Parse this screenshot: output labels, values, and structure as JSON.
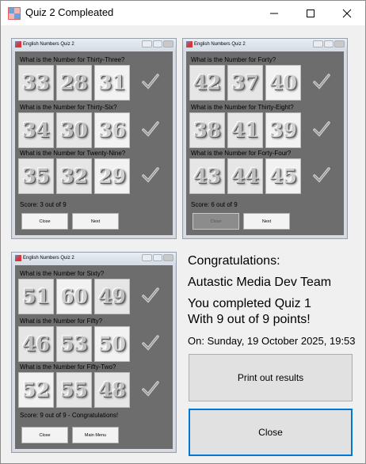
{
  "window": {
    "title": "Quiz 2 Compleated",
    "controls": [
      "minimize",
      "maximize",
      "close"
    ]
  },
  "screenshots": [
    {
      "title": "English Numbers Quiz 2",
      "questions": [
        {
          "text": "What is the Number for Thirty-Three?",
          "options": [
            "33",
            "28",
            "31"
          ]
        },
        {
          "text": "What is the Number for Thirty-Six?",
          "options": [
            "34",
            "30",
            "36"
          ]
        },
        {
          "text": "What is the Number for Twenty-Nine?",
          "options": [
            "35",
            "32",
            "29"
          ]
        }
      ],
      "score": "Score: 3 out of 9",
      "buttons": [
        "Close",
        "Next"
      ]
    },
    {
      "title": "English Numbers Quiz 2",
      "questions": [
        {
          "text": "What is the Number for Forty?",
          "options": [
            "42",
            "37",
            "40"
          ]
        },
        {
          "text": "What is the Number for Thirty-Eight?",
          "options": [
            "38",
            "41",
            "39"
          ]
        },
        {
          "text": "What is the Number for Forty-Four?",
          "options": [
            "43",
            "44",
            "45"
          ]
        }
      ],
      "score": "Score: 6 out of 9",
      "buttons": [
        "Close",
        "Next"
      ]
    },
    {
      "title": "English Numbers Quiz 2",
      "questions": [
        {
          "text": "What is the Number for Sixty?",
          "options": [
            "51",
            "60",
            "49"
          ]
        },
        {
          "text": "What is the Number for Fifty?",
          "options": [
            "46",
            "53",
            "50"
          ]
        },
        {
          "text": "What is the Number for Fifty-Two?",
          "options": [
            "52",
            "55",
            "48"
          ]
        }
      ],
      "score": "Score: 9 out of 9 - Congratulations!",
      "buttons": [
        "Close",
        "Main Menu"
      ]
    }
  ],
  "results": {
    "congrats": "Congratulations:",
    "team": "Autastic Media Dev Team",
    "line1": "You completed Quiz 1",
    "line2": "With 9 out of 9 points!",
    "date": "On: Sunday, 19 October 2025, 19:53",
    "print_button": "Print out results",
    "close_button": "Close"
  }
}
